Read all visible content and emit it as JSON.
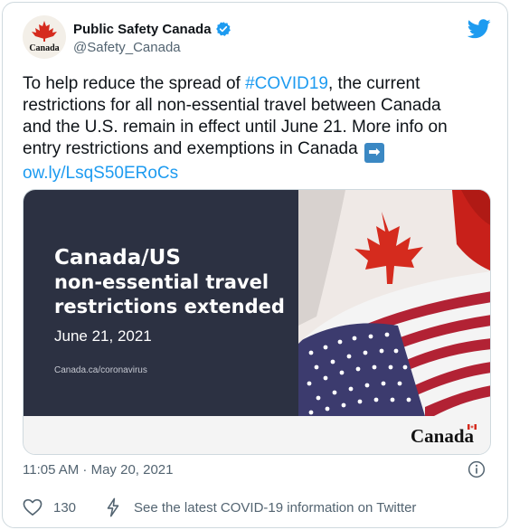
{
  "account": {
    "display_name": "Public Safety Canada",
    "handle": "@Safety_Canada",
    "avatar_word": "Canada",
    "verified": true
  },
  "tweet": {
    "line1_pre": "To help reduce the spread of ",
    "hashtag": "#COVID19",
    "line1_post": ", the current",
    "line2": "restrictions for all non-essential travel between Canada",
    "line3": "and the U.S. remain in effect until June 21. More info on",
    "line4": "entry restrictions and exemptions in Canada",
    "arrow_emoji": "➡",
    "link": "ow.ly/LsqS50ERoCs"
  },
  "media": {
    "title_line1": "Canada/US",
    "title_line2": "non-essential travel",
    "title_line3": "restrictions extended",
    "date": "June 21, 2021",
    "url": "Canada.ca/coronavirus",
    "wordmark": "Canada"
  },
  "meta": {
    "timestamp": "11:05 AM · May 20, 2021"
  },
  "actions": {
    "like_count": "130",
    "covid_info": "See the latest COVID-19 information on Twitter"
  },
  "colors": {
    "link_blue": "#1d9bf0",
    "twitter_blue": "#1d9bf0",
    "media_navy": "#2c3142",
    "flag_red": "#d52b1e"
  },
  "icons": [
    "verified-badge-icon",
    "twitter-bird-icon",
    "info-icon",
    "heart-icon",
    "lightning-icon",
    "right-arrow-emoji"
  ]
}
